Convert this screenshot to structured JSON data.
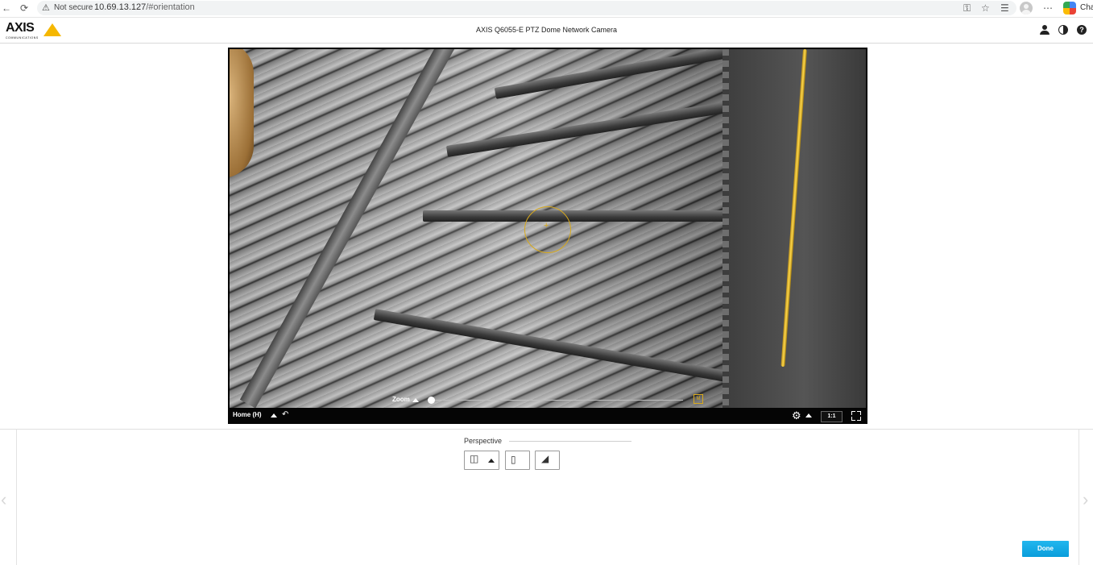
{
  "browser": {
    "security_label": "Not secure",
    "url_host": "10.69.13.127",
    "url_path": "/#orientation",
    "chat_label": "Chat"
  },
  "header": {
    "logo_text": "AXIS",
    "logo_subtext": "COMMUNICATIONS",
    "camera_title": "AXIS Q6055-E PTZ Dome Network Camera",
    "help_glyph": "?"
  },
  "viewer": {
    "zoom_label": "Zoom",
    "zoom_level": 0,
    "home_label": "Home (H)",
    "ratio_label": "1:1",
    "zoom_max_glyph": "M"
  },
  "panel": {
    "section_title": "Perspective",
    "done_label": "Done"
  },
  "colors": {
    "accent": "#0a9ddb",
    "brand_yellow": "#f5b700",
    "reticle": "#d8a91c"
  },
  "icons": [
    "back-icon",
    "reload-icon",
    "warning-icon",
    "key-icon",
    "star-icon",
    "bookmarks-icon",
    "menu-icon",
    "user-icon",
    "contrast-icon",
    "help-icon",
    "settings-icon",
    "fullscreen-icon",
    "return-icon"
  ]
}
